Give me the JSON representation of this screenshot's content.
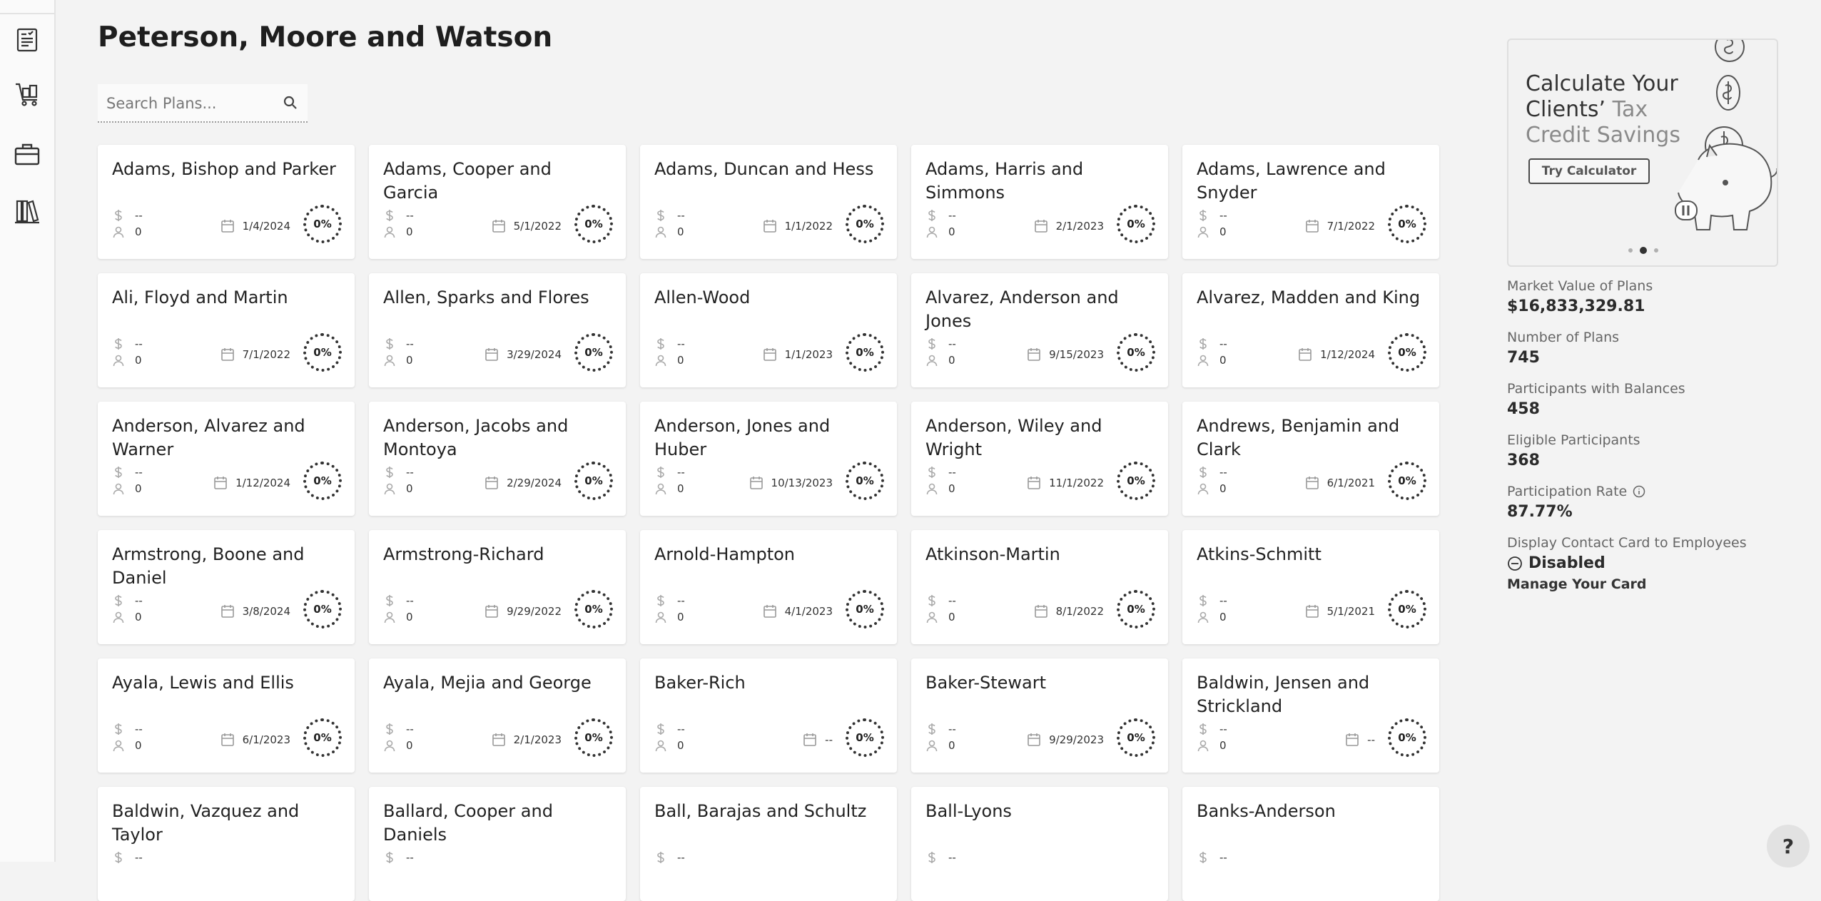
{
  "nav": {
    "items": [
      {
        "name": "plans-icon"
      },
      {
        "name": "cart-icon"
      },
      {
        "name": "briefcase-icon"
      },
      {
        "name": "library-icon"
      }
    ]
  },
  "header": {
    "title": "Peterson, Moore and Watson"
  },
  "search": {
    "placeholder": "Search Plans..."
  },
  "plans": [
    {
      "name": "Adams, Bishop and Parker",
      "value": "--",
      "participants": "0",
      "date": "1/4/2024",
      "rate": "0%"
    },
    {
      "name": "Adams, Cooper and Garcia",
      "value": "--",
      "participants": "0",
      "date": "5/1/2022",
      "rate": "0%"
    },
    {
      "name": "Adams, Duncan and Hess",
      "value": "--",
      "participants": "0",
      "date": "1/1/2022",
      "rate": "0%"
    },
    {
      "name": "Adams, Harris and Simmons",
      "value": "--",
      "participants": "0",
      "date": "2/1/2023",
      "rate": "0%"
    },
    {
      "name": "Adams, Lawrence and Snyder",
      "value": "--",
      "participants": "0",
      "date": "7/1/2022",
      "rate": "0%"
    },
    {
      "name": "Ali, Floyd and Martin",
      "value": "--",
      "participants": "0",
      "date": "7/1/2022",
      "rate": "0%"
    },
    {
      "name": "Allen, Sparks and Flores",
      "value": "--",
      "participants": "0",
      "date": "3/29/2024",
      "rate": "0%"
    },
    {
      "name": "Allen-Wood",
      "value": "--",
      "participants": "0",
      "date": "1/1/2023",
      "rate": "0%"
    },
    {
      "name": "Alvarez, Anderson and Jones",
      "value": "--",
      "participants": "0",
      "date": "9/15/2023",
      "rate": "0%"
    },
    {
      "name": "Alvarez, Madden and King",
      "value": "--",
      "participants": "0",
      "date": "1/12/2024",
      "rate": "0%"
    },
    {
      "name": "Anderson, Alvarez and Warner",
      "value": "--",
      "participants": "0",
      "date": "1/12/2024",
      "rate": "0%"
    },
    {
      "name": "Anderson, Jacobs and Montoya",
      "value": "--",
      "participants": "0",
      "date": "2/29/2024",
      "rate": "0%"
    },
    {
      "name": "Anderson, Jones and Huber",
      "value": "--",
      "participants": "0",
      "date": "10/13/2023",
      "rate": "0%"
    },
    {
      "name": "Anderson, Wiley and Wright",
      "value": "--",
      "participants": "0",
      "date": "11/1/2022",
      "rate": "0%"
    },
    {
      "name": "Andrews, Benjamin and Clark",
      "value": "--",
      "participants": "0",
      "date": "6/1/2021",
      "rate": "0%"
    },
    {
      "name": "Armstrong, Boone and Daniel",
      "value": "--",
      "participants": "0",
      "date": "3/8/2024",
      "rate": "0%"
    },
    {
      "name": "Armstrong-Richard",
      "value": "--",
      "participants": "0",
      "date": "9/29/2022",
      "rate": "0%"
    },
    {
      "name": "Arnold-Hampton",
      "value": "--",
      "participants": "0",
      "date": "4/1/2023",
      "rate": "0%"
    },
    {
      "name": "Atkinson-Martin",
      "value": "--",
      "participants": "0",
      "date": "8/1/2022",
      "rate": "0%"
    },
    {
      "name": "Atkins-Schmitt",
      "value": "--",
      "participants": "0",
      "date": "5/1/2021",
      "rate": "0%"
    },
    {
      "name": "Ayala, Lewis and Ellis",
      "value": "--",
      "participants": "0",
      "date": "6/1/2023",
      "rate": "0%"
    },
    {
      "name": "Ayala, Mejia and George",
      "value": "--",
      "participants": "0",
      "date": "2/1/2023",
      "rate": "0%"
    },
    {
      "name": "Baker-Rich",
      "value": "--",
      "participants": "0",
      "date": "--",
      "rate": "0%"
    },
    {
      "name": "Baker-Stewart",
      "value": "--",
      "participants": "0",
      "date": "9/29/2023",
      "rate": "0%"
    },
    {
      "name": "Baldwin, Jensen and Strickland",
      "value": "--",
      "participants": "0",
      "date": "--",
      "rate": "0%"
    },
    {
      "name": "Baldwin, Vazquez and Taylor",
      "value": "--",
      "participants": "",
      "date": "",
      "rate": ""
    },
    {
      "name": "Ballard, Cooper and Daniels",
      "value": "--",
      "participants": "",
      "date": "",
      "rate": ""
    },
    {
      "name": "Ball, Barajas and Schultz",
      "value": "--",
      "participants": "",
      "date": "",
      "rate": ""
    },
    {
      "name": "Ball-Lyons",
      "value": "--",
      "participants": "",
      "date": "",
      "rate": ""
    },
    {
      "name": "Banks-Anderson",
      "value": "--",
      "participants": "",
      "date": "",
      "rate": ""
    }
  ],
  "promo": {
    "line1": "Calculate Your Clients’",
    "highlight": "Tax Credit Savings",
    "button": "Try Calculator",
    "slide_count": 3,
    "active_slide": 2
  },
  "stats": {
    "market_value_label": "Market Value of Plans",
    "market_value": "$16,833,329.81",
    "num_plans_label": "Number of Plans",
    "num_plans": "745",
    "participants_balances_label": "Participants with Balances",
    "participants_balances": "458",
    "eligible_label": "Eligible Participants",
    "eligible": "368",
    "rate_label": "Participation Rate",
    "rate": "87.77%",
    "contact_card_label": "Display Contact Card to Employees",
    "contact_card_status": "Disabled",
    "manage_link": "Manage Your Card"
  },
  "help": {
    "label": "?"
  },
  "colors": {
    "background": "#f3f3f3",
    "card": "#ffffff",
    "text": "#1f1f1f",
    "muted": "#666666"
  }
}
